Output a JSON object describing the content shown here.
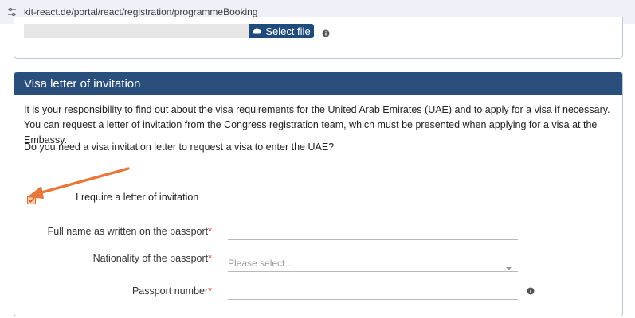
{
  "browser": {
    "url": "kit-react.de/portal/react/registration/programmeBooking",
    "site_info_icon": "tune-icon"
  },
  "upload_section": {
    "select_file_label": "Select file",
    "select_file_icon": "upload-icon",
    "info_icon": "info-icon"
  },
  "visa_section": {
    "title": "Visa letter of invitation",
    "intro": "It is your responsibility to find out about the visa requirements for the United Arab Emirates (UAE) and to apply for a visa if necessary. You can request a letter of invitation from the Congress registration team, which must be presented when applying for a visa at the Embassy.",
    "question": "Do you need a visa invitation letter to request a visa to enter the UAE?",
    "checkbox": {
      "label": "I require a letter of invitation",
      "checked": true
    },
    "fields": {
      "full_name": {
        "label": "Full name as written on the passport",
        "required_mark": "*",
        "value": ""
      },
      "nationality": {
        "label": "Nationality of the passport",
        "required_mark": "*",
        "placeholder": "Please select..."
      },
      "passport_number": {
        "label": "Passport number",
        "required_mark": "*",
        "value": "",
        "info_icon": "info-icon"
      }
    }
  },
  "annotation": {
    "type": "arrow",
    "color": "#e8773a",
    "points_to": "checkbox"
  },
  "colors": {
    "header_bg": "#2a4f7d",
    "button_bg": "#1f4a7c",
    "required": "#d9362b",
    "checkbox_accent": "#e06a2c"
  }
}
